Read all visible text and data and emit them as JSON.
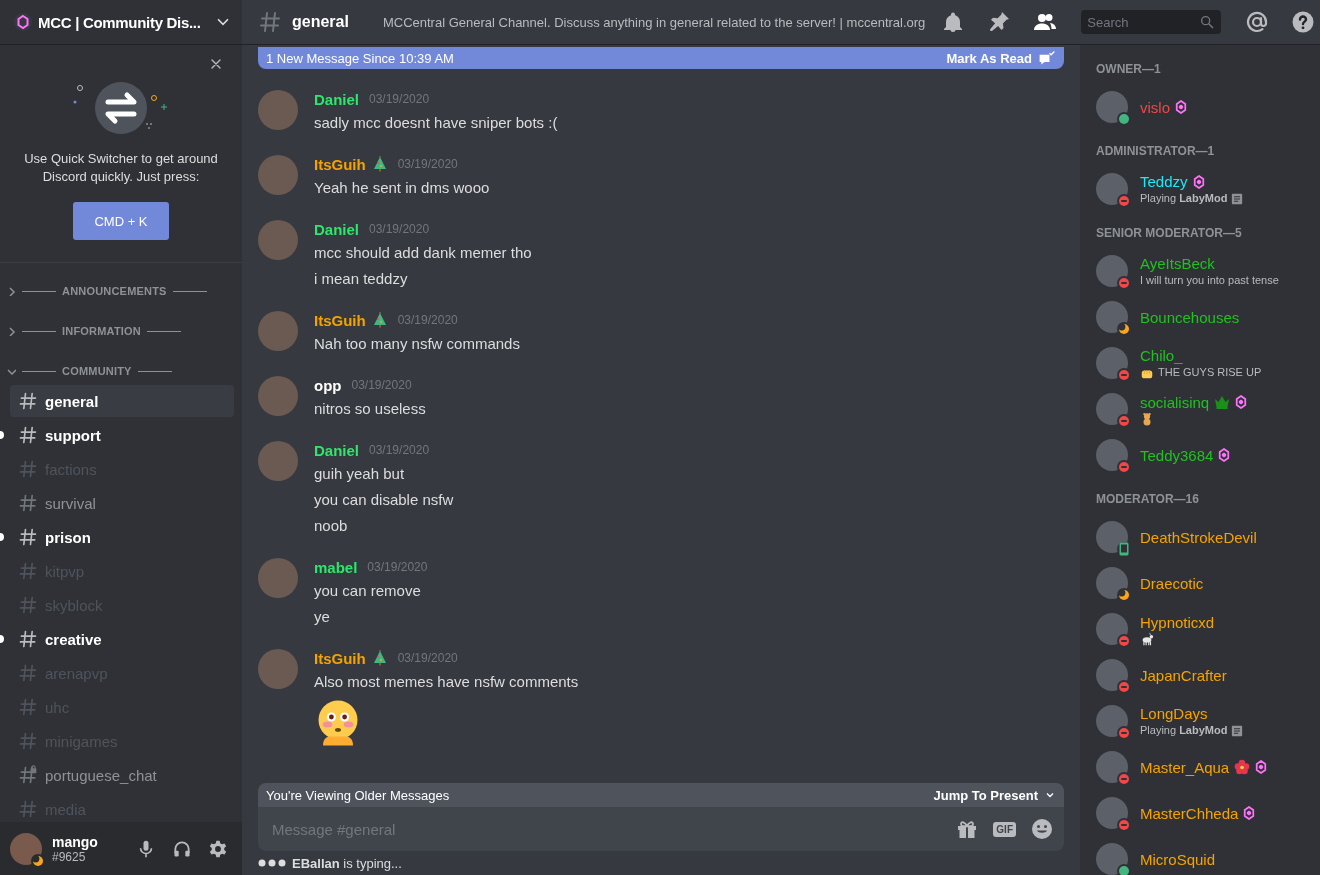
{
  "server": {
    "name": "MCC | Community Dis..."
  },
  "quick_switcher": {
    "text": "Use Quick Switcher to get around Discord quickly. Just press:",
    "shortcut": "CMD + K"
  },
  "categories": [
    {
      "name": "ANNOUNCEMENTS",
      "expanded": false
    },
    {
      "name": "INFORMATION",
      "expanded": false
    },
    {
      "name": "COMMUNITY",
      "expanded": true,
      "channels": [
        {
          "name": "general",
          "selected": true,
          "unread": false,
          "muted": false,
          "locked": false
        },
        {
          "name": "support",
          "selected": false,
          "unread": true,
          "muted": false,
          "locked": false
        },
        {
          "name": "factions",
          "selected": false,
          "unread": false,
          "muted": true,
          "locked": false
        },
        {
          "name": "survival",
          "selected": false,
          "unread": false,
          "muted": false,
          "locked": false
        },
        {
          "name": "prison",
          "selected": false,
          "unread": true,
          "muted": false,
          "locked": false
        },
        {
          "name": "kitpvp",
          "selected": false,
          "unread": false,
          "muted": true,
          "locked": false
        },
        {
          "name": "skyblock",
          "selected": false,
          "unread": false,
          "muted": true,
          "locked": false
        },
        {
          "name": "creative",
          "selected": false,
          "unread": true,
          "muted": false,
          "locked": false
        },
        {
          "name": "arenapvp",
          "selected": false,
          "unread": false,
          "muted": true,
          "locked": false
        },
        {
          "name": "uhc",
          "selected": false,
          "unread": false,
          "muted": true,
          "locked": false
        },
        {
          "name": "minigames",
          "selected": false,
          "unread": false,
          "muted": true,
          "locked": false
        },
        {
          "name": "portuguese_chat",
          "selected": false,
          "unread": false,
          "muted": false,
          "locked": true
        },
        {
          "name": "media",
          "selected": false,
          "unread": false,
          "muted": true,
          "locked": false
        }
      ]
    }
  ],
  "user": {
    "name": "mango",
    "tag": "#9625",
    "status": {
      "kind": "idle"
    }
  },
  "channel": {
    "name": "general",
    "topic": "MCCentral General Channel. Discuss anything in general related to the server! | mccentral.org"
  },
  "search": {
    "placeholder": "Search"
  },
  "banner": {
    "text": "1 New Message Since 10:39 AM",
    "action": "Mark As Read"
  },
  "messages": [
    {
      "author": "Daniel",
      "color": "#2ee66b",
      "time": "03/19/2020",
      "lines": [
        {
          "kind": "text",
          "text": "sadly mcc doesnt have sniper bots :("
        }
      ]
    },
    {
      "author": "ItsGuih",
      "color": "#f5a300",
      "emoji": {
        "kind": "tree"
      },
      "time": "03/19/2020",
      "lines": [
        {
          "kind": "text",
          "text": "Yeah he sent in dms wooo"
        }
      ]
    },
    {
      "author": "Daniel",
      "color": "#2ee66b",
      "time": "03/19/2020",
      "lines": [
        {
          "kind": "text",
          "text": "mcc should add dank memer tho"
        },
        {
          "kind": "text",
          "text": "i mean teddzy"
        }
      ]
    },
    {
      "author": "ItsGuih",
      "color": "#f5a300",
      "emoji": {
        "kind": "tree"
      },
      "time": "03/19/2020",
      "lines": [
        {
          "kind": "text",
          "text": "Nah too many nsfw commands"
        }
      ]
    },
    {
      "author": "opp",
      "color": "#ffffff",
      "time": "03/19/2020",
      "lines": [
        {
          "kind": "text",
          "text": "nitros so useless"
        }
      ]
    },
    {
      "author": "Daniel",
      "color": "#2ee66b",
      "time": "03/19/2020",
      "lines": [
        {
          "kind": "text",
          "text": "guih yeah but"
        },
        {
          "kind": "text",
          "text": "you can disable nsfw"
        },
        {
          "kind": "text",
          "text": "noob"
        }
      ]
    },
    {
      "author": "mabel",
      "color": "#2ee66b",
      "time": "03/19/2020",
      "lines": [
        {
          "kind": "text",
          "text": "you can remove"
        },
        {
          "kind": "text",
          "text": "ye"
        }
      ]
    },
    {
      "author": "ItsGuih",
      "color": "#f5a300",
      "emoji": {
        "kind": "tree"
      },
      "time": "03/19/2020",
      "lines": [
        {
          "kind": "text",
          "text": "Also most memes have nsfw comments"
        },
        {
          "kind": "emoji"
        }
      ]
    }
  ],
  "older_bar": {
    "text": "You're Viewing Older Messages",
    "action": "Jump To Present"
  },
  "composer": {
    "placeholder": "Message #general",
    "gif": "GIF"
  },
  "typing": "**EBallan** is typing...",
  "member_groups": [
    {
      "title": "OWNER—1",
      "members": [
        {
          "name": "vislo",
          "color": "#f04747",
          "status": {
            "kind": "online"
          },
          "booster": true
        }
      ]
    },
    {
      "title": "ADMINISTRATOR—1",
      "members": [
        {
          "name": "Teddzy",
          "color": "#1de9f6",
          "status": {
            "kind": "dnd"
          },
          "booster": true,
          "activity": {
            "text": "Playing **LabyMod**",
            "rich_presence": true
          }
        }
      ]
    },
    {
      "title": "SENIOR MODERATOR—5",
      "members": [
        {
          "name": "AyeItsBeck",
          "color": "#1fc21f",
          "status": {
            "kind": "dnd"
          },
          "activity": {
            "text": "I will turn you into past tense"
          }
        },
        {
          "name": "Bouncehouses",
          "color": "#1fc21f",
          "status": {
            "kind": "idle"
          }
        },
        {
          "name": "Chilo_",
          "color": "#1fc21f",
          "status": {
            "kind": "dnd"
          },
          "activity": {
            "emoji": {
              "kind": "fist"
            },
            "text": "THE GUYS RISE UP"
          }
        },
        {
          "name": "socialisinq",
          "color": "#1fc21f",
          "status": {
            "kind": "dnd"
          },
          "emoji": {
            "kind": "crown"
          },
          "booster": true,
          "activity": {
            "emoji": {
              "kind": "teddy"
            }
          }
        },
        {
          "name": "Teddy3684",
          "color": "#1fc21f",
          "status": {
            "kind": "dnd"
          },
          "booster": true
        }
      ]
    },
    {
      "title": "MODERATOR—16",
      "members": [
        {
          "name": "DeathStrokeDevil",
          "color": "#f5a300",
          "status": {
            "kind": "mobile"
          }
        },
        {
          "name": "Draecotic",
          "color": "#f5a300",
          "status": {
            "kind": "idle"
          }
        },
        {
          "name": "Hypnoticxd",
          "color": "#f5a300",
          "status": {
            "kind": "dnd"
          },
          "activity": {
            "emoji": {
              "kind": "goat"
            }
          }
        },
        {
          "name": "JapanCrafter",
          "color": "#f5a300",
          "status": {
            "kind": "dnd"
          }
        },
        {
          "name": "LongDays",
          "color": "#f5a300",
          "status": {
            "kind": "dnd"
          },
          "activity": {
            "text": "Playing **LabyMod**",
            "rich_presence": true
          }
        },
        {
          "name": "Master_Aqua",
          "color": "#f5a300",
          "status": {
            "kind": "dnd"
          },
          "emoji": {
            "kind": "flower"
          },
          "booster": true
        },
        {
          "name": "MasterChheda",
          "color": "#f5a300",
          "status": {
            "kind": "dnd"
          },
          "booster": true
        },
        {
          "name": "MicroSquid",
          "color": "#f5a300",
          "status": {
            "kind": "online"
          }
        }
      ]
    }
  ]
}
